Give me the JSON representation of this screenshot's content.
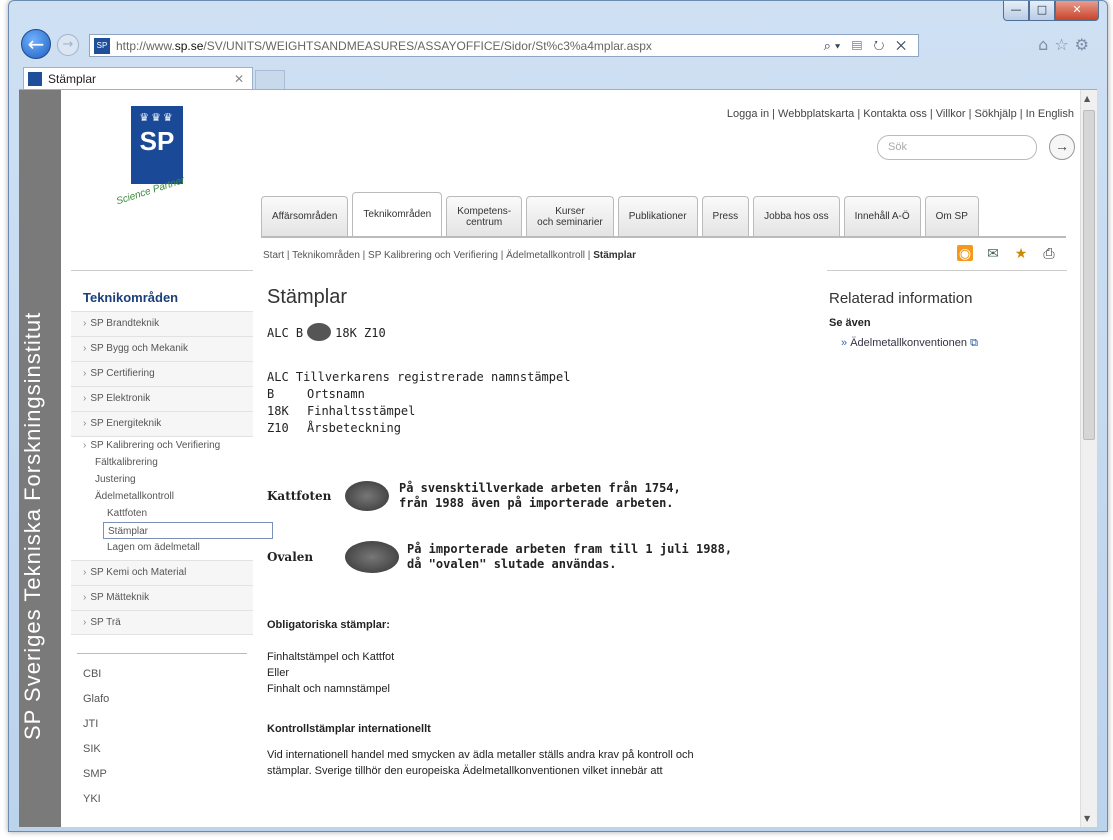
{
  "browser": {
    "url_prefix": "http://www.",
    "url_domain": "sp.se",
    "url_rest": "/SV/UNITS/WEIGHTSANDMEASURES/ASSAYOFFICE/Sidor/St%c3%a4mplar.aspx",
    "tab_title": "Stämplar",
    "window_buttons": {
      "min": "—",
      "max": "□",
      "close": "✕"
    }
  },
  "sidebar_band": "SP Sveriges Tekniska Forskningsinstitut",
  "header": {
    "logo": "SP",
    "partner": "Science Partner",
    "top_links": "Logga in | Webbplatskarta | Kontakta oss | Villkor | Sökhjälp | In English",
    "search_placeholder": "Sök"
  },
  "nav_tabs": [
    "Affärsområden",
    "Teknikområden",
    "Kompetens-\ncentrum",
    "Kurser\noch seminarier",
    "Publikationer",
    "Press",
    "Jobba hos oss",
    "Innehåll A-Ö",
    "Om SP"
  ],
  "breadcrumb": {
    "path": "Start | Teknikområden | SP Kalibrering och Verifiering | Ädelmetallkontroll | ",
    "current": "Stämplar"
  },
  "left_nav": {
    "heading": "Teknikområden",
    "items_top": [
      "SP Brandteknik",
      "SP Bygg och Mekanik",
      "SP Certifiering",
      "SP Elektronik",
      "SP Energiteknik"
    ],
    "open_item": "SP Kalibrering och Verifiering",
    "sub": [
      "Fältkalibrering",
      "Justering"
    ],
    "open_sub": "Ädelmetallkontroll",
    "sub2": [
      "Kattfoten"
    ],
    "selected": "Stämplar",
    "sub2_after": [
      "Lagen om ädelmetall"
    ],
    "items_bottom": [
      "SP Kemi och Material",
      "SP Mätteknik",
      "SP Trä"
    ],
    "plain": [
      "CBI",
      "Glafo",
      "JTI",
      "SIK",
      "SMP",
      "YKI"
    ]
  },
  "content": {
    "title": "Stämplar",
    "stamp_line_a": "ALC B",
    "stamp_line_b": "18K Z10",
    "legend": [
      {
        "code": "ALC",
        "desc": "Tillverkarens registrerade namnstämpel"
      },
      {
        "code": "B",
        "desc": "Ortsnamn"
      },
      {
        "code": "18K",
        "desc": "Finhaltsstämpel"
      },
      {
        "code": "Z10",
        "desc": "Årsbeteckning"
      }
    ],
    "kattfoten_label": "Kattfoten",
    "kattfoten_text1": "På svensktillverkade arbeten från 1754,",
    "kattfoten_text2": "från 1988 även på importerade arbeten.",
    "ovalen_label": "Ovalen",
    "ovalen_text1": "På importerade arbeten fram till 1 juli 1988,",
    "ovalen_text2": "då \"ovalen\" slutade användas.",
    "oblig_heading": "Obligatoriska stämplar:",
    "oblig_1": "Finhaltstämpel och Kattfot",
    "oblig_2": "Eller",
    "oblig_3": "Finhalt och namnstämpel",
    "intl_heading": "Kontrollstämplar internationellt",
    "intl_1": "Vid internationell handel med smycken av ädla metaller ställs andra krav på kontroll och",
    "intl_2": "stämplar. Sverige tillhör den europeiska Ädelmetallkonventionen vilket innebär att"
  },
  "related": {
    "heading": "Relaterad information",
    "see_also": "Se även",
    "link": "Ädelmetallkonventionen"
  }
}
